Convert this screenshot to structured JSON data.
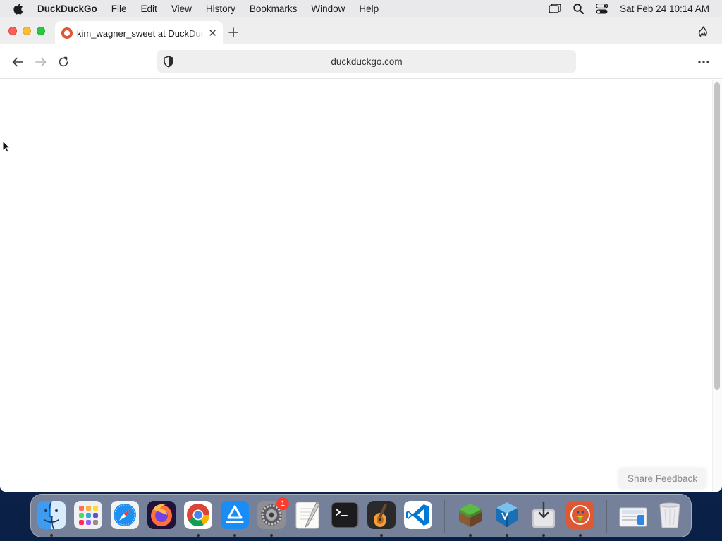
{
  "menubar": {
    "app_name": "DuckDuckGo",
    "menus": [
      "File",
      "Edit",
      "View",
      "History",
      "Bookmarks",
      "Window",
      "Help"
    ],
    "clock": "Sat Feb 24  10:14 AM",
    "icons": [
      "apple-logo-icon",
      "window-stack-icon",
      "spotlight-search-icon",
      "control-center-icon"
    ]
  },
  "browser": {
    "tab": {
      "title": "kim_wagner_sweet at DuckDuckGo",
      "favicon": "duckduckgo-favicon-icon",
      "close_icon": "close-icon"
    },
    "new_tab_icon": "plus-icon",
    "fire_icon": "fire-icon",
    "nav": {
      "back_icon": "arrow-left-icon",
      "forward_icon": "arrow-right-icon",
      "reload_icon": "reload-icon"
    },
    "address": {
      "url": "duckduckgo.com",
      "shield_icon": "privacy-shield-icon"
    },
    "menu_icon": "ellipsis-icon",
    "feedback_button": "Share Feedback"
  },
  "dock": {
    "apps": [
      {
        "name": "finder",
        "running": true
      },
      {
        "name": "launchpad",
        "running": false
      },
      {
        "name": "safari",
        "running": false
      },
      {
        "name": "firefox",
        "running": false
      },
      {
        "name": "chrome",
        "running": true
      },
      {
        "name": "app-store",
        "running": true
      },
      {
        "name": "system-settings",
        "running": true,
        "badge": "1"
      },
      {
        "name": "textedit",
        "running": false
      },
      {
        "name": "terminal",
        "running": false
      },
      {
        "name": "garageband",
        "running": true
      },
      {
        "name": "vscode",
        "running": false
      },
      {
        "name": "minecraft",
        "running": true
      },
      {
        "name": "virtualbox",
        "running": true
      },
      {
        "name": "installer",
        "running": true
      },
      {
        "name": "duckduckgo",
        "running": true
      },
      {
        "name": "downloads-stack",
        "running": false
      },
      {
        "name": "trash",
        "running": false
      }
    ]
  },
  "colors": {
    "close": "#ff5f57",
    "minimize": "#febc2e",
    "maximize": "#28c840",
    "duckduckgo_brand": "#de5833",
    "badge": "#ff3b30"
  }
}
